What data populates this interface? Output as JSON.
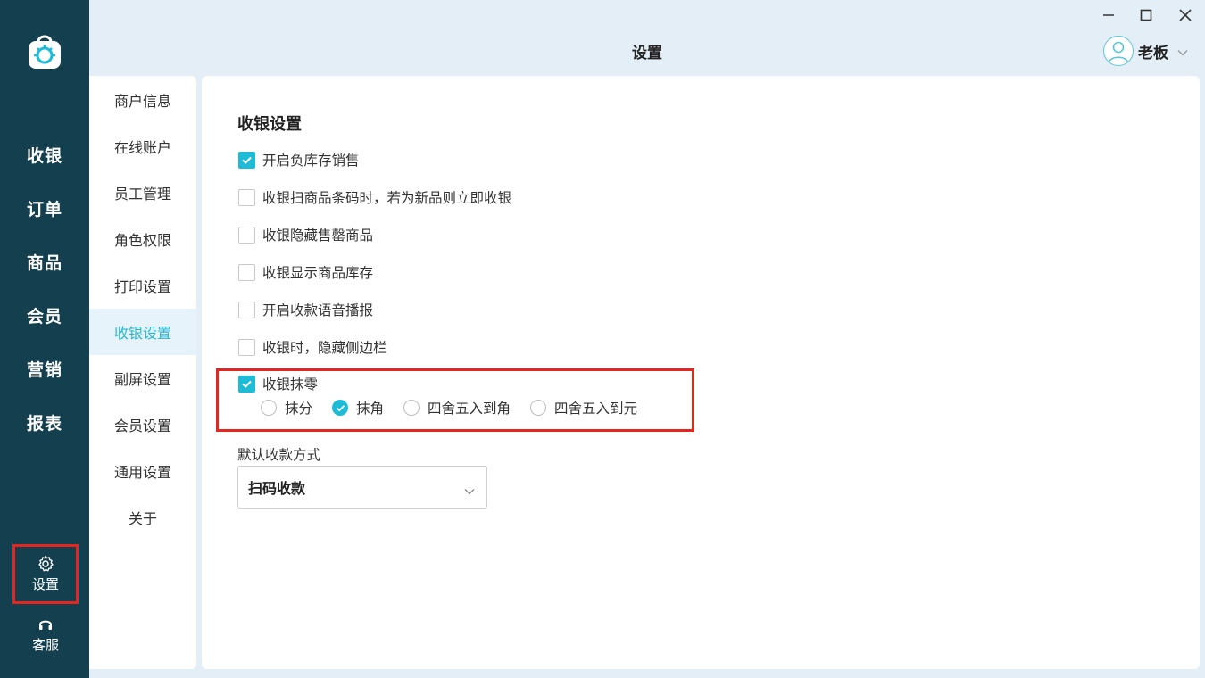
{
  "app": {
    "title": "设置",
    "window_controls": [
      "minimize-icon",
      "maximize-icon",
      "close-icon"
    ]
  },
  "user": {
    "name": "老板"
  },
  "nav": {
    "items": [
      "收银",
      "订单",
      "商品",
      "会员",
      "营销",
      "报表"
    ],
    "settings_label": "设置",
    "service_label": "客服"
  },
  "submenu": {
    "items": [
      "商户信息",
      "在线账户",
      "员工管理",
      "角色权限",
      "打印设置",
      "收银设置",
      "副屏设置",
      "会员设置",
      "通用设置",
      "关于"
    ],
    "active": "收银设置"
  },
  "cashier_settings": {
    "title": "收银设置",
    "options": [
      {
        "label": "开启负库存销售",
        "checked": true
      },
      {
        "label": "收银扫商品条码时，若为新品则立即收银",
        "checked": false
      },
      {
        "label": "收银隐藏售罄商品",
        "checked": false
      },
      {
        "label": "收银显示商品库存",
        "checked": false
      },
      {
        "label": "开启收款语音播报",
        "checked": false
      },
      {
        "label": "收银时，隐藏侧边栏",
        "checked": false
      },
      {
        "label": "收银抹零",
        "checked": true
      }
    ],
    "rounding": {
      "options": [
        "抹分",
        "抹角",
        "四舍五入到角",
        "四舍五入到元"
      ],
      "selected": "抹角"
    },
    "payment": {
      "label": "默认收款方式",
      "value": "扫码收款"
    }
  },
  "colors": {
    "nav_bg": "#133f4f",
    "accent": "#1ebbd7",
    "highlight": "#e3261f",
    "page_bg": "#e3eef6"
  }
}
